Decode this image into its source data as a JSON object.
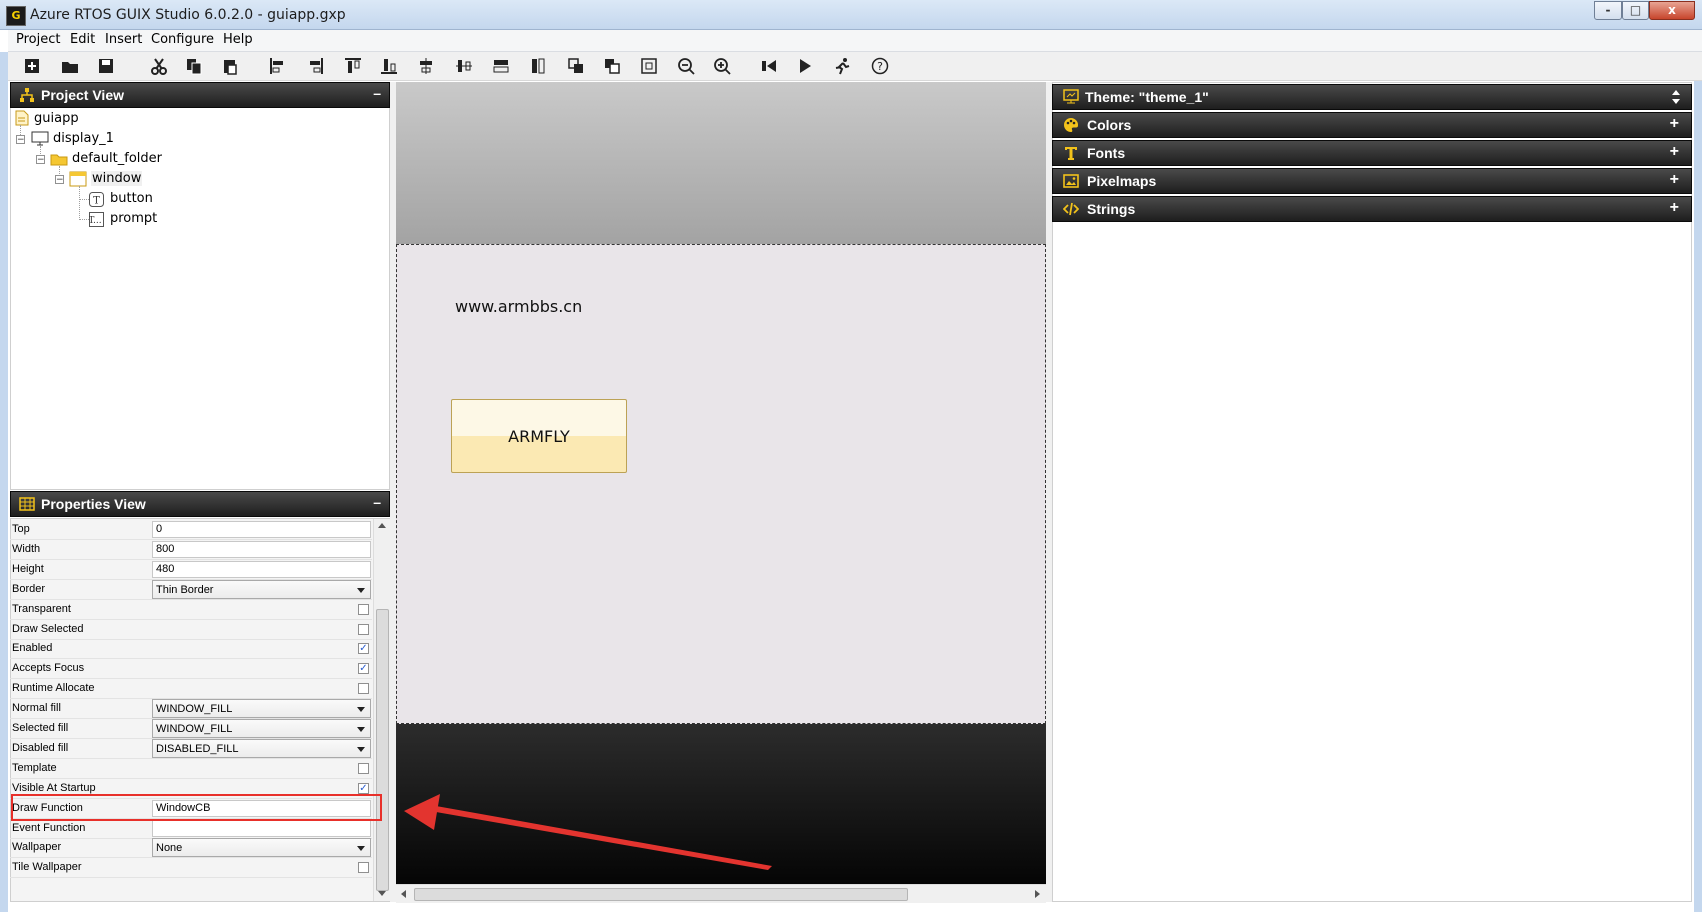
{
  "window": {
    "title": "Azure RTOS GUIX Studio 6.0.2.0 - guiapp.gxp",
    "app_icon": "G"
  },
  "window_buttons": {
    "minimize": "-",
    "maximize": "□",
    "close": "x"
  },
  "menu": [
    "Project",
    "Edit",
    "Insert",
    "Configure",
    "Help"
  ],
  "toolbar_icons": [
    "new-project-icon",
    "open-folder-icon",
    "save-icon",
    "cut-icon",
    "copy-icon",
    "paste-icon",
    "align-left-icon",
    "align-right-icon",
    "align-top-icon",
    "align-bottom-icon",
    "center-horizontal-icon",
    "center-vertical-icon",
    "equal-width-icon",
    "equal-height-icon",
    "move-to-front-icon",
    "move-to-back-icon",
    "size-to-fit-icon",
    "zoom-out-icon",
    "zoom-in-icon",
    "record-macro-icon",
    "play-macro-icon",
    "run-application-icon",
    "help-icon"
  ],
  "project_view": {
    "title": "Project View",
    "minimize": "–",
    "tree": {
      "root": "guiapp",
      "display": "display_1",
      "folder": "default_folder",
      "window": "window",
      "children": [
        "button",
        "prompt"
      ]
    }
  },
  "properties_view": {
    "title": "Properties View",
    "minimize": "–",
    "rows": [
      {
        "label": "Top",
        "type": "text",
        "value": "0"
      },
      {
        "label": "Width",
        "type": "text",
        "value": "800"
      },
      {
        "label": "Height",
        "type": "text",
        "value": "480"
      },
      {
        "label": "Border",
        "type": "select",
        "value": "Thin Border"
      },
      {
        "label": "Transparent",
        "type": "check",
        "checked": false
      },
      {
        "label": "Draw Selected",
        "type": "check",
        "checked": false
      },
      {
        "label": "Enabled",
        "type": "check",
        "checked": true
      },
      {
        "label": "Accepts Focus",
        "type": "check",
        "checked": true
      },
      {
        "label": "Runtime Allocate",
        "type": "check",
        "checked": false
      },
      {
        "label": "Normal fill",
        "type": "select",
        "value": "WINDOW_FILL"
      },
      {
        "label": "Selected fill",
        "type": "select",
        "value": "WINDOW_FILL"
      },
      {
        "label": "Disabled fill",
        "type": "select",
        "value": "DISABLED_FILL"
      },
      {
        "label": "Template",
        "type": "check",
        "checked": false
      },
      {
        "label": "Visible At Startup",
        "type": "check",
        "checked": true
      },
      {
        "label": "Draw Function",
        "type": "text",
        "value": "WindowCB"
      },
      {
        "label": "Event Function",
        "type": "text",
        "value": ""
      },
      {
        "label": "Wallpaper",
        "type": "select",
        "value": "None"
      },
      {
        "label": "Tile Wallpaper",
        "type": "check",
        "checked": false
      }
    ],
    "highlighted_row": "Draw Function"
  },
  "canvas": {
    "prompt_text": "www.armbbs.cn",
    "button_text": "ARMFLY"
  },
  "resource_view": {
    "theme_label": "Theme: \"theme_1\"",
    "sections": [
      {
        "label": "Colors",
        "icon": "palette-icon"
      },
      {
        "label": "Fonts",
        "icon": "font-icon"
      },
      {
        "label": "Pixelmaps",
        "icon": "picture-icon"
      },
      {
        "label": "Strings",
        "icon": "code-icon"
      }
    ],
    "expand": "+"
  },
  "colors": {
    "panel_header": "#2a2a2a",
    "icon_yellow": "#f2c21b",
    "highlight_red": "#e8302a",
    "arrow_red": "#e3342f"
  }
}
